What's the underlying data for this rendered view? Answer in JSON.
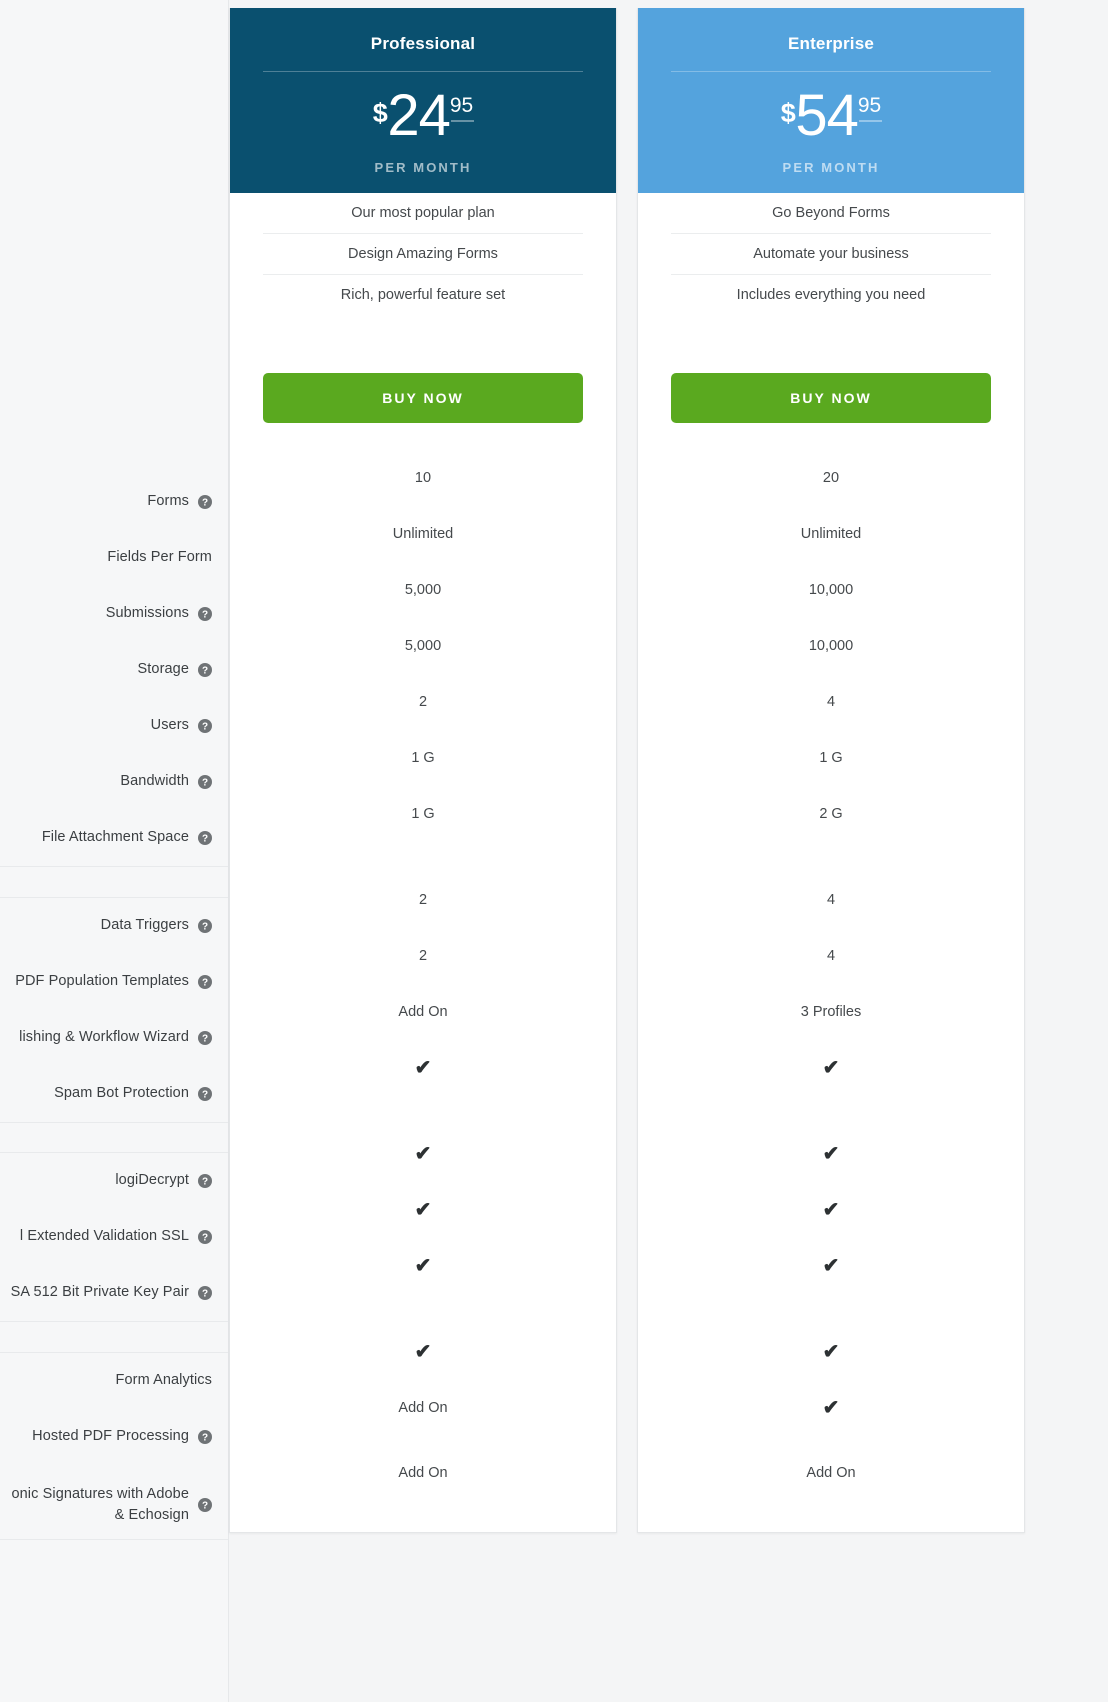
{
  "colors": {
    "page_bg": "#f4f5f6",
    "professional_header": "#0a506f",
    "enterprise_header": "#54a3dd",
    "buy_button": "#5aa91f",
    "text": "#45494c"
  },
  "plans": [
    {
      "id": "professional",
      "name": "Professional",
      "currency": "$",
      "price_int": "24",
      "price_dec": "95",
      "period": "PER MONTH",
      "taglines": [
        "Our most popular plan",
        "Design Amazing Forms",
        "Rich, powerful feature set"
      ],
      "cta": "BUY NOW"
    },
    {
      "id": "enterprise",
      "name": "Enterprise",
      "currency": "$",
      "price_int": "54",
      "price_dec": "95",
      "period": "PER MONTH",
      "taglines": [
        "Go Beyond Forms",
        "Automate your business",
        "Includes everything you need"
      ],
      "cta": "BUY NOW"
    }
  ],
  "sections": [
    {
      "rows": [
        {
          "label": "Forms",
          "help": true,
          "professional": "10",
          "enterprise": "20"
        },
        {
          "label": "Fields Per Form",
          "help": false,
          "professional": "Unlimited",
          "enterprise": "Unlimited"
        },
        {
          "label": "Submissions",
          "help": true,
          "professional": "5,000",
          "enterprise": "10,000"
        },
        {
          "label": "Storage",
          "help": true,
          "professional": "5,000",
          "enterprise": "10,000"
        },
        {
          "label": "Users",
          "help": true,
          "professional": "2",
          "enterprise": "4"
        },
        {
          "label": "Bandwidth",
          "help": true,
          "professional": "1 G",
          "enterprise": "1 G"
        },
        {
          "label": "File Attachment Space",
          "help": true,
          "professional": "1 G",
          "enterprise": "2 G"
        }
      ]
    },
    {
      "rows": [
        {
          "label": "Data Triggers",
          "help": true,
          "professional": "2",
          "enterprise": "4"
        },
        {
          "label": "PDF Population Templates",
          "help": true,
          "professional": "2",
          "enterprise": "4"
        },
        {
          "label": "lishing & Workflow Wizard",
          "help": true,
          "professional": "Add On",
          "enterprise": "3 Profiles"
        },
        {
          "label": "Spam Bot Protection",
          "help": true,
          "professional": "check",
          "enterprise": "check"
        }
      ]
    },
    {
      "rows": [
        {
          "label": "logiDecrypt",
          "help": true,
          "professional": "check",
          "enterprise": "check"
        },
        {
          "label": "l Extended Validation SSL",
          "help": true,
          "professional": "check",
          "enterprise": "check"
        },
        {
          "label": "SA 512 Bit Private Key Pair",
          "help": true,
          "professional": "check",
          "enterprise": "check"
        }
      ]
    },
    {
      "rows": [
        {
          "label": "Form Analytics",
          "help": false,
          "professional": "check",
          "enterprise": "check"
        },
        {
          "label": "Hosted PDF Processing",
          "help": true,
          "professional": "Add On",
          "enterprise": "check"
        },
        {
          "label": "onic Signatures with Adobe & Echosign",
          "help": true,
          "professional": "Add On",
          "enterprise": "Add On",
          "twoline": true
        }
      ]
    }
  ],
  "icons": {
    "help": "help-circle-icon",
    "check": "✔"
  }
}
